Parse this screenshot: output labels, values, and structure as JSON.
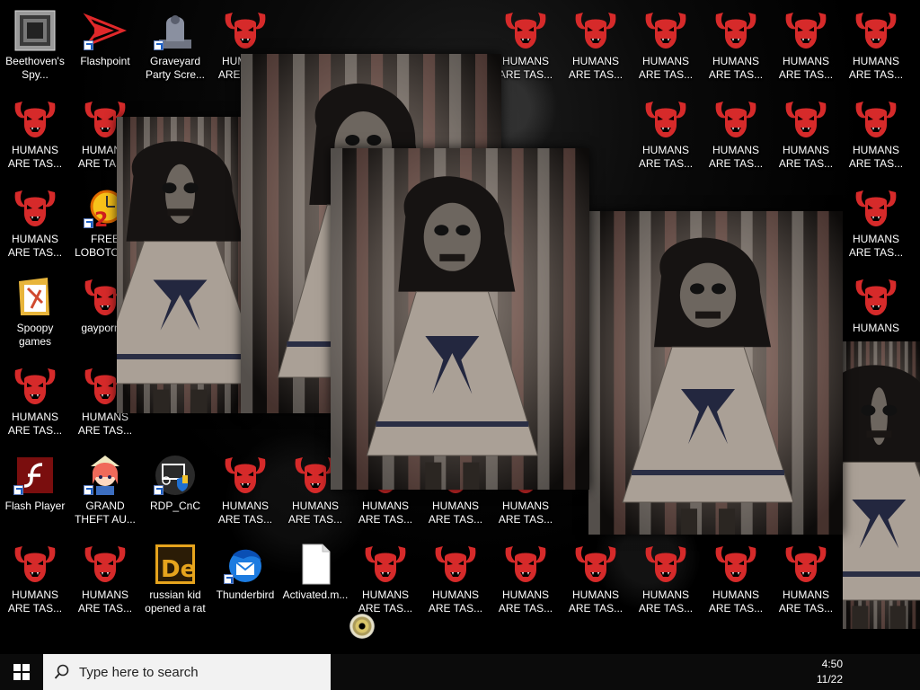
{
  "colors": {
    "taskbar": "#0b0b0b",
    "search_bg": "#f2f2f2",
    "demon_red": "#d62a2a",
    "label_text": "#ffffff"
  },
  "desktop": {
    "icons": [
      {
        "id": "beethoven",
        "label": "Beethoven's Spy...",
        "glyph": "screenshot-icon",
        "shortcut": false
      },
      {
        "id": "flashpoint",
        "label": "Flashpoint",
        "glyph": "flashpoint-icon",
        "shortcut": true
      },
      {
        "id": "graveyard",
        "label": "Graveyard Party Scre...",
        "glyph": "tombstone-icon",
        "shortcut": true
      },
      {
        "id": "humans",
        "label": "HUMANS ARE TAS...",
        "glyph": "demon-icon"
      },
      {
        "id": "humans_short",
        "label": "HUMANS",
        "glyph": "demon-icon"
      },
      {
        "id": "lobotomy",
        "label": "FREE LOBOTOMY",
        "glyph": "clock-icon",
        "shortcut": true
      },
      {
        "id": "spoopy",
        "label": "Spoopy games",
        "glyph": "folder-icon"
      },
      {
        "id": "gayporn",
        "label": "gayporn...",
        "glyph": "demon-icon"
      },
      {
        "id": "flashplayer",
        "label": "Flash Player",
        "glyph": "flash-player-icon",
        "shortcut": true
      },
      {
        "id": "gta",
        "label": "GRAND THEFT AU...",
        "glyph": "anime-girl-icon",
        "shortcut": true
      },
      {
        "id": "rdp",
        "label": "RDP_CnC",
        "glyph": "rdp-icon",
        "shortcut": true
      },
      {
        "id": "russian",
        "label": "russian kid opened a rat",
        "glyph": "de-icon"
      },
      {
        "id": "thunderbird",
        "label": "Thunderbird",
        "glyph": "thunderbird-icon",
        "shortcut": true
      },
      {
        "id": "activated",
        "label": "Activated.m...",
        "glyph": "blank-file-icon"
      }
    ]
  },
  "taskbar": {
    "search_placeholder": "Type here to search",
    "time": "4:50",
    "date": "11/22",
    "start_icon": "windows-logo-icon",
    "search_icon": "search-icon"
  }
}
